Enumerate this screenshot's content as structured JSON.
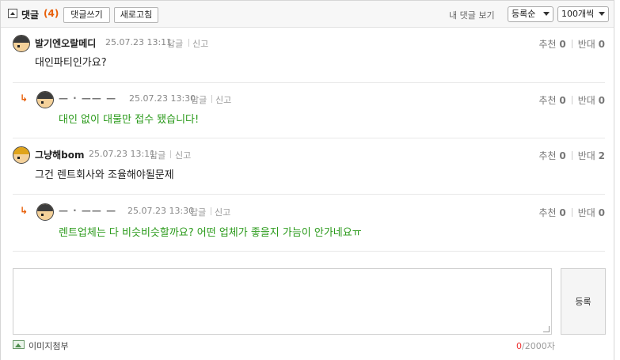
{
  "header": {
    "title": "댓글",
    "count": "(4)",
    "write_button": "댓글쓰기",
    "refresh_button": "새로고침",
    "my_comments": "내 댓글 보기",
    "sort_select": "등록순",
    "per_page_select": "100개씩"
  },
  "comments": [
    {
      "nickname": "발기엔오랄메디",
      "date": "25.07.23 13:11",
      "reply": "답글",
      "report": "신고",
      "text": "대인파티인가요?",
      "up_label": "추천",
      "up": "0",
      "down_label": "반대",
      "down": "0"
    },
    {
      "nickname": "— · —— —",
      "date": "25.07.23 13:30",
      "reply": "답글",
      "report": "신고",
      "text": "대인 없이 대물만 접수 됐습니다!",
      "up_label": "추천",
      "up": "0",
      "down_label": "반대",
      "down": "0"
    },
    {
      "nickname": "그냥해bom",
      "date": "25.07.23 13:11",
      "reply": "답글",
      "report": "신고",
      "text": "그건 렌트회사와 조율해야될문제",
      "up_label": "추천",
      "up": "0",
      "down_label": "반대",
      "down": "2"
    },
    {
      "nickname": "— · —— —",
      "date": "25.07.23 13:30",
      "reply": "답글",
      "report": "신고",
      "text": "렌트업체는 다 비슷비슷할까요? 어떤 업체가 좋을지 가늠이 안가네요ㅠ",
      "up_label": "추천",
      "up": "0",
      "down_label": "반대",
      "down": "0"
    }
  ],
  "reply_marker": "↳",
  "input": {
    "submit_label": "등록",
    "image_attach_label": "이미지첨부",
    "char_current": "0",
    "char_max": "/2000자"
  },
  "colors": {
    "accent_orange": "#e8600a",
    "reply_text_green": "#2a9a1a",
    "counter_red": "#e33333"
  }
}
